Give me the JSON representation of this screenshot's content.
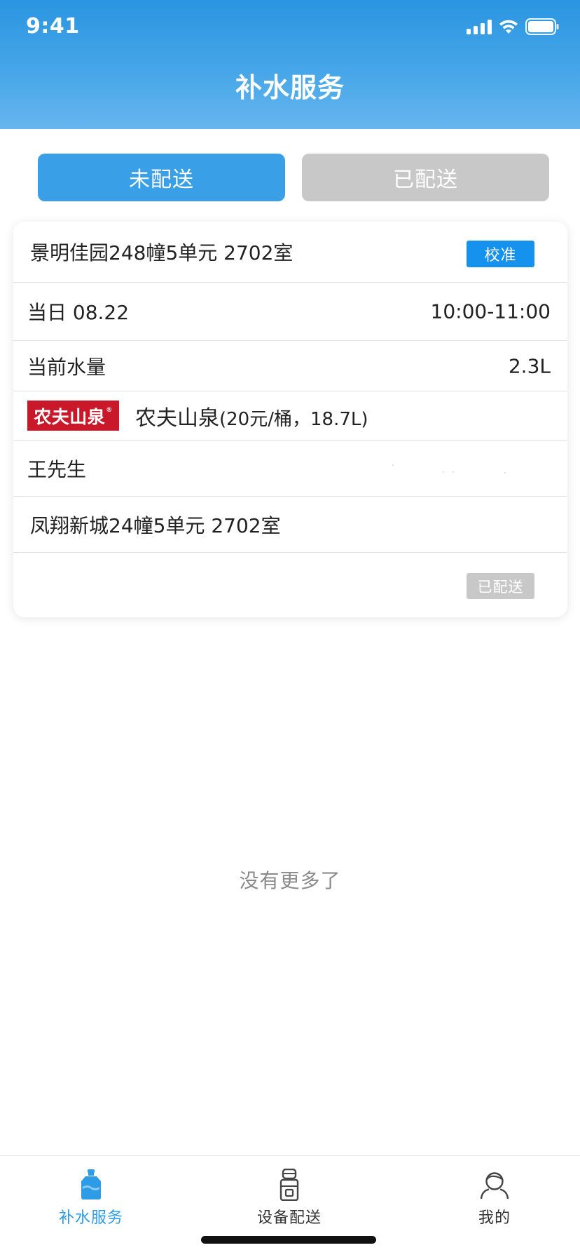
{
  "status_bar": {
    "time": "9:41"
  },
  "header": {
    "title": "补水服务"
  },
  "tabs": [
    {
      "label": "未配送",
      "active": true
    },
    {
      "label": "已配送",
      "active": false
    }
  ],
  "order": {
    "device_address": "景明佳园248幢5单元 2702室",
    "calibrate_label": "校准",
    "date_label": "当日 08.22",
    "time_slot": "10:00-11:00",
    "water_level_label": "当前水量",
    "water_level_value": "2.3L",
    "brand_logo_text": "农夫山泉",
    "product_name": "农夫山泉",
    "product_spec": "(20元/桶，18.7L)",
    "contact_name": "王先生",
    "delivery_address": "凤翔新城24幢5单元 2702室",
    "status_label": "已配送"
  },
  "empty_hint": "没有更多了",
  "tabbar": {
    "items": [
      {
        "label": "补水服务",
        "icon": "water-bottle-icon",
        "active": true
      },
      {
        "label": "设备配送",
        "icon": "water-dispenser-icon",
        "active": false
      },
      {
        "label": "我的",
        "icon": "user-profile-icon",
        "active": false
      }
    ]
  },
  "colors": {
    "primary": "#39a0e7",
    "header_gradient_top": "#2a95e0",
    "header_gradient_bottom": "#66b6ee",
    "calibrate_button": "#1592ee",
    "inactive_grey": "#c8c8c8",
    "brand_red": "#c8182a",
    "tab_active_text": "#2e9be6"
  }
}
